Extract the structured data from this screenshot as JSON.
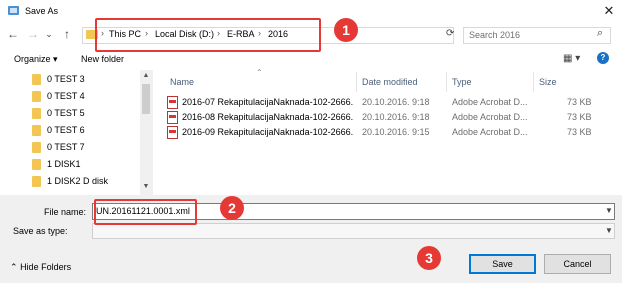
{
  "window": {
    "title": "Save As",
    "close_glyph": "✕"
  },
  "nav": {
    "back": "←",
    "forward": "→",
    "dropdown": "⌄",
    "up": "↑",
    "refresh": "⟳"
  },
  "address": {
    "crumbs": [
      "This PC",
      "Local Disk (D:)",
      "E-RBA",
      "2016"
    ],
    "separator": "›"
  },
  "search": {
    "placeholder": "Search 2016",
    "icon": "search-icon"
  },
  "toolbar": {
    "organize": "Organize ▾",
    "new_folder": "New folder",
    "help": "?"
  },
  "tree": {
    "items": [
      "0 TEST 3",
      "0 TEST 4",
      "0 TEST 5",
      "0 TEST 6",
      "0 TEST 7",
      "1 DISK1",
      "1 DISK2 D disk"
    ]
  },
  "columns": {
    "name": "Name",
    "date": "Date modified",
    "type": "Type",
    "size": "Size"
  },
  "files": [
    {
      "name": "2016-07 RekapitulacijaNaknada-102-2666...",
      "date": "20.10.2016. 9:18",
      "type": "Adobe Acrobat D...",
      "size": "73 KB"
    },
    {
      "name": "2016-08 RekapitulacijaNaknada-102-2666...",
      "date": "20.10.2016. 9:18",
      "type": "Adobe Acrobat D...",
      "size": "73 KB"
    },
    {
      "name": "2016-09 RekapitulacijaNaknada-102-2666...",
      "date": "20.10.2016. 9:15",
      "type": "Adobe Acrobat D...",
      "size": "73 KB"
    }
  ],
  "form": {
    "file_name_label": "File name:",
    "file_name_value": "UN.20161121.0001.xml",
    "save_as_type_label": "Save as type:",
    "save_as_type_value": ""
  },
  "footer": {
    "hide_folders": "Hide Folders",
    "save": "Save",
    "cancel": "Cancel"
  },
  "callouts": [
    "1",
    "2",
    "3"
  ],
  "colors": {
    "callout": "#e53935",
    "accent": "#0078d7",
    "folder": "#f3c654"
  }
}
